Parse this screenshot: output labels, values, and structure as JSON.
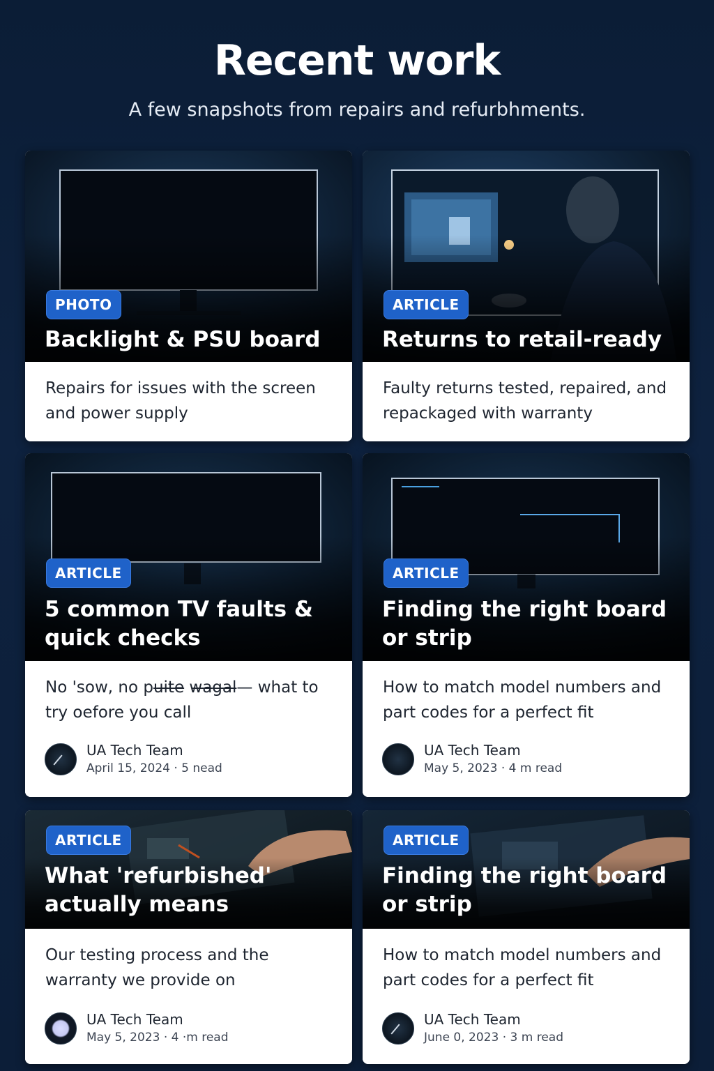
{
  "header": {
    "title": "Recent work",
    "subtitle": "A few snapshots from repairs and refurbhments."
  },
  "cards": [
    {
      "badge": "PHOTO",
      "title": "Backlight & PSU board",
      "description": "Repairs for issues with the screen and power supply"
    },
    {
      "badge": "ARTICLE",
      "title": "Returns to retail-ready",
      "description": "Faulty returns tested, repaired, and repackaged with warranty"
    },
    {
      "badge": "ARTICLE",
      "title": "5 common TV faults & quick checks",
      "description": "No 'sow, no pu̶i̶t̶e̶ w̶a̶g̶a̶l̶— what to try oefore you call",
      "author": "UA Tech Team",
      "meta": "April 15, 2024 · 5 nead"
    },
    {
      "badge": "ARTICLE",
      "title": "Finding the right board or strip",
      "description": "How to match model numbers and part codes for a perfect fit",
      "author": "UA Tech Team",
      "meta": "May 5, 2023 · 4 m read"
    },
    {
      "badge": "ARTICLE",
      "title": "What 'refurbished' actually means",
      "description": "Our testing process and the warranty we provide on",
      "author": "UA Tech Team",
      "meta": "May 5, 2023 · 4 ·m read"
    },
    {
      "badge": "ARTICLE",
      "title": "Finding the right board or strip",
      "description": "How to match model numbers and part codes for a perfect fit",
      "author": "UA Tech Team",
      "meta": "June 0, 2023 · 3 m read"
    }
  ]
}
